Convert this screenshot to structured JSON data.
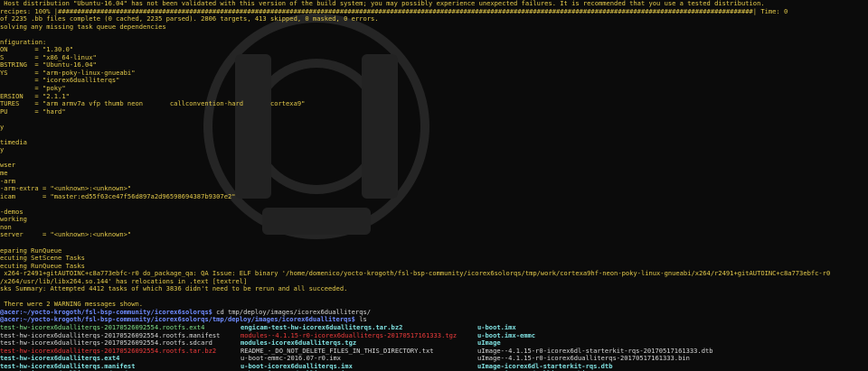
{
  "lines": [
    {
      "t": " Host distribution \"Ubuntu-16.04\" has not been validated with this version of the build system; you may possibly experience unexpected failures. It is recommended that you use a tested distribution.",
      "c": "y"
    },
    {
      "t": "recipes: 100% |####################################################################################################################################################################################| Time: 0",
      "c": "y"
    },
    {
      "t": "of 2235 .bb files complete (0 cached, 2235 parsed). 2806 targets, 413 skipped, 0 masked, 0 errors.",
      "c": "y"
    },
    {
      "t": "solving any missing task queue dependencies",
      "c": "y"
    },
    {
      "t": "",
      "c": "y"
    },
    {
      "t": "nfiguration:",
      "c": "y"
    },
    {
      "t": "ON       = \"1.30.0\"",
      "c": "y"
    },
    {
      "t": "S        = \"x86_64-linux\"",
      "c": "y"
    },
    {
      "t": "BSTRING  = \"Ubuntu-16.04\"",
      "c": "y"
    },
    {
      "t": "YS       = \"arm-poky-linux-gnueabi\"",
      "c": "y"
    },
    {
      "t": "         = \"icorex6dualliterqs\"",
      "c": "y"
    },
    {
      "t": "         = \"poky\"",
      "c": "y"
    },
    {
      "t": "ERSION   = \"2.1.1\"",
      "c": "y"
    },
    {
      "t": "TURES    = \"arm armv7a vfp thumb neon       callconvention-hard       cortexa9\"",
      "c": "y"
    },
    {
      "t": "PU       = \"hard\"",
      "c": "y"
    },
    {
      "t": "",
      "c": "y"
    },
    {
      "t": "y",
      "c": "y"
    },
    {
      "t": "",
      "c": "y"
    },
    {
      "t": "timedia",
      "c": "y"
    },
    {
      "t": "y",
      "c": "y"
    },
    {
      "t": "",
      "c": "y"
    },
    {
      "t": "wser",
      "c": "y"
    },
    {
      "t": "me",
      "c": "y"
    },
    {
      "t": "-arm",
      "c": "y"
    },
    {
      "t": "-arm-extra = \"<unknown>:<unknown>\"",
      "c": "y"
    },
    {
      "t": "icam       = \"master:ed55f63ce47f56d897a2d96598694387b9307e2\"",
      "c": "y"
    },
    {
      "t": "",
      "c": "y"
    },
    {
      "t": "-demos",
      "c": "y"
    },
    {
      "t": "working",
      "c": "y"
    },
    {
      "t": "non",
      "c": "y"
    },
    {
      "t": "server     = \"<unknown>:<unknown>\"",
      "c": "y"
    },
    {
      "t": "",
      "c": "y"
    },
    {
      "t": "eparing RunQueue",
      "c": "y"
    },
    {
      "t": "ecuting SetScene Tasks",
      "c": "y"
    },
    {
      "t": "ecuting RunQueue Tasks",
      "c": "y"
    },
    {
      "t": " x264-r2491+gitAUTOINC+c8a773ebfc-r0 do_package_qa: QA Issue: ELF binary '/home/domenico/yocto-krogoth/fsl-bsp-community/icorex6solorqs/tmp/work/cortexa9hf-neon-poky-linux-gnueabi/x264/r2491+gitAUTOINC+c8a773ebfc-r0",
      "c": "y"
    },
    {
      "t": "/x264/usr/lib/libx264.so.144' has relocations in .text [textrel]",
      "c": "y"
    },
    {
      "t": "sks Summary: Attempted 4412 tasks of which 3836 didn't need to be rerun and all succeeded.",
      "c": "y"
    },
    {
      "t": "",
      "c": "y"
    },
    {
      "t": " There were 2 WARNING messages shown.",
      "c": "y"
    }
  ],
  "prompts": [
    {
      "path": "@acer:~/yocto-krogoth/fsl-bsp-community/icorex6solorqs$",
      "cmd": " cd tmp/deploy/images/icorex6dualliterqs/"
    },
    {
      "path": "@acer:~/yocto-krogoth/fsl-bsp-community/icorex6solorqs/tmp/deploy/images/icorex6dualliterqs$",
      "cmd": " ls"
    }
  ],
  "ls_rows": [
    [
      {
        "t": "test-hw-icorex6dualliterqs-20170526092554.rootfs.ext4",
        "c": "g"
      },
      {
        "t": "engicam-test-hw-icorex6dualliterqs.tar.bz2",
        "c": "c"
      },
      {
        "t": "u-boot.imx",
        "c": "c"
      }
    ],
    [
      {
        "t": "test-hw-icorex6dualliterqs-20170526092554.rootfs.manifest",
        "c": "w"
      },
      {
        "t": "modules--4.1.15-r0-icorex6dualliterqs-20170517161333.tgz",
        "c": "r"
      },
      {
        "t": "u-boot.imx-emmc",
        "c": "c"
      }
    ],
    [
      {
        "t": "test-hw-icorex6dualliterqs-20170526092554.rootfs.sdcard",
        "c": "w"
      },
      {
        "t": "modules-icorex6dualliterqs.tgz",
        "c": "c"
      },
      {
        "t": "uImage",
        "c": "c"
      }
    ],
    [
      {
        "t": "test-hw-icorex6dualliterqs-20170526092554.rootfs.tar.bz2",
        "c": "r"
      },
      {
        "t": "README_-_DO_NOT_DELETE_FILES_IN_THIS_DIRECTORY.txt",
        "c": "w"
      },
      {
        "t": "uImage--4.1.15-r0-icorex6dl-starterkit-rqs-20170517161333.dtb",
        "c": "w"
      }
    ],
    [
      {
        "t": "test-hw-icorex6dualliterqs.ext4",
        "c": "c"
      },
      {
        "t": "u-boot-emmc-2016.07-r0.imx",
        "c": "w"
      },
      {
        "t": "uImage--4.1.15-r0-icorex6dualliterqs-20170517161333.bin",
        "c": "w"
      }
    ],
    [
      {
        "t": "test-hw-icorex6dualliterqs.manifest",
        "c": "c"
      },
      {
        "t": "u-boot-icorex6dualliterqs.imx",
        "c": "c"
      },
      {
        "t": "uImage-icorex6dl-starterkit-rqs.dtb",
        "c": "c"
      }
    ],
    [
      {
        "t": "test-hw-icorex6dualliterqs.sdcard",
        "c": "c"
      },
      {
        "t": "u-boot-icorex6dualliterqs.imx-emmc",
        "c": "c"
      },
      {
        "t": "uImage-icorex6dualliterqs.bin",
        "c": "c"
      }
    ]
  ],
  "final_prompt": {
    "path": "@acer:~/yocto-krogoth/fsl-bsp-community/icorex6solorqs/tmp/deploy/images/icorex6dualliterqs$",
    "cmd": " "
  },
  "colors": {
    "background": "#0b0b0b",
    "warning": "#e3c94a",
    "prompt": "#6f8cff",
    "cursor": "#2bd147",
    "archive": "#ef3b3b",
    "symlink": "#7fe0e0"
  }
}
